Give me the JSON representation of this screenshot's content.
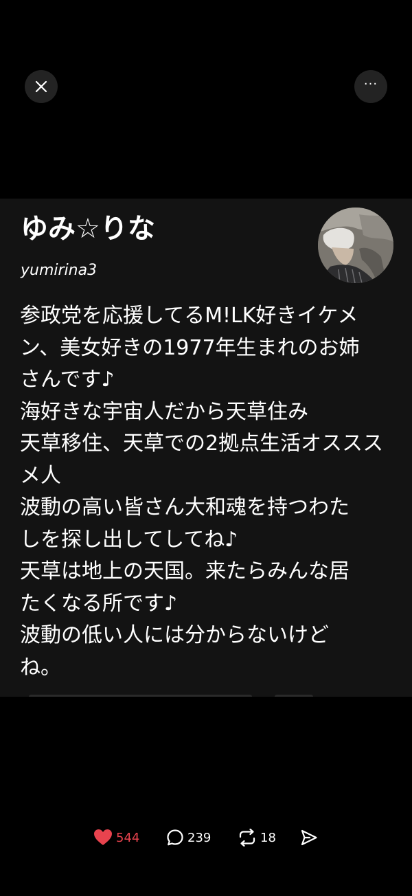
{
  "toolbar": {
    "close_icon": "close-icon",
    "more_label": "···"
  },
  "profile": {
    "display_name": "ゆみ☆りな",
    "handle": "yumirina3",
    "bio_lines": [
      "参政党を応援してるM!LK好きイケメ",
      "ン、美女好きの1977年生まれのお姉",
      "さんです♪",
      "海好きな宇宙人だから天草住み",
      "天草移住、天草での2拠点生活オススス",
      "メ人",
      "波動の高い皆さん大和魂を持つわた",
      "しを探し出してしてね♪",
      "天草は地上の天国。来たらみんな居",
      "たくなる所です♪",
      "波動の低い人には分からないけど",
      "ね。"
    ]
  },
  "actions": {
    "likes": "544",
    "replies": "239",
    "reposts": "18"
  },
  "colors": {
    "background": "#000000",
    "card": "#131313",
    "like_accent": "#e8434e"
  }
}
